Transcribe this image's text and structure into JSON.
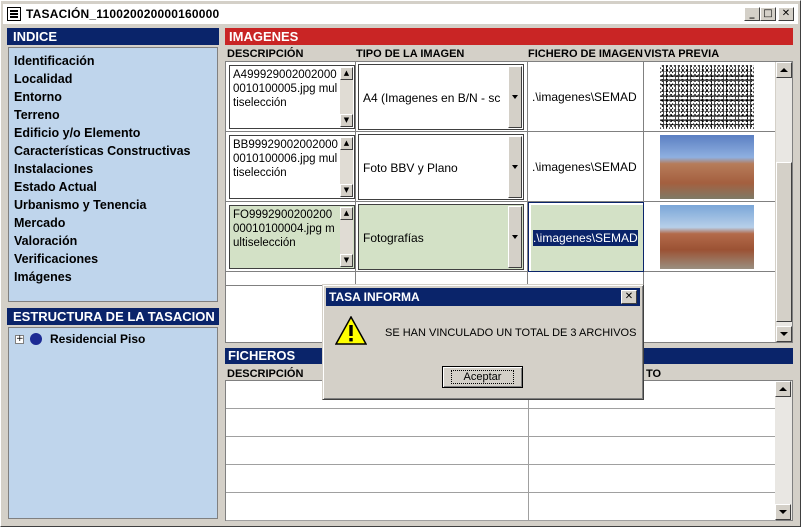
{
  "window": {
    "title": "TASACIÓN_110020020000160000",
    "buttons": {
      "minimize": "_",
      "maximize": "□",
      "close": "✕"
    }
  },
  "indice": {
    "title": "INDICE",
    "items": [
      "Identificación",
      "Localidad",
      "Entorno",
      "Terreno",
      "Edificio y/o Elemento",
      "Características Constructivas",
      "Instalaciones",
      "Estado Actual",
      "Urbanismo y Tenencia",
      "Mercado",
      "Valoración",
      "Verificaciones",
      "Imágenes"
    ]
  },
  "estructura": {
    "title": "ESTRUCTURA DE LA TASACION",
    "tree_expand": "+",
    "node_label": "Residencial Piso"
  },
  "imagenes": {
    "title": "IMAGENES",
    "columns": [
      "DESCRIPCIÓN",
      "TIPO DE LA IMAGEN",
      "FICHERO DE IMAGEN",
      "VISTA PREVIA"
    ],
    "rows": [
      {
        "descripcion": "A4999290020020000010100005.jpg multiselección",
        "tipo": "A4 (Imagenes en B/N - sc",
        "fichero": ".\\imagenes\\SEMAD",
        "preview": "noise"
      },
      {
        "descripcion": "BB999290020020000010100006.jpg multiselección",
        "tipo": "Foto BBV y Plano",
        "fichero": ".\\imagenes\\SEMAD",
        "preview": "photo"
      },
      {
        "descripcion": "FO999290020020000010100004.jpg multiselección",
        "tipo": "Fotografías",
        "fichero": ".\\imagenes\\SEMAD",
        "preview": "photo"
      }
    ]
  },
  "ficheros": {
    "title": "FICHEROS",
    "columns": [
      "DESCRIPCIÓN",
      "TO"
    ]
  },
  "dialog": {
    "title": "TASA INFORMA",
    "message": "SE HAN VINCULADO UN TOTAL DE 3 ARCHIVOS",
    "button": "Aceptar",
    "close": "✕",
    "icon": "warning-icon"
  },
  "colors": {
    "header_blue": "#0a246a",
    "imagenes_red": "#c92525",
    "panel_bg": "#bfd5ec",
    "selected_row": "#d3e1c6"
  }
}
